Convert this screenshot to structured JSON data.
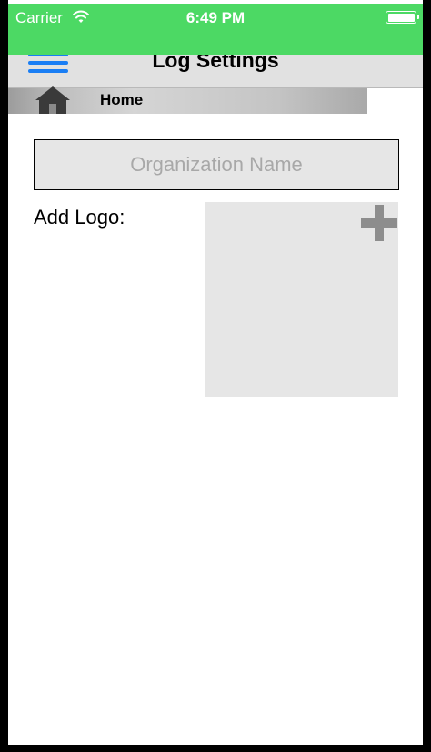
{
  "status_bar": {
    "carrier": "Carrier",
    "time": "6:49 PM",
    "wifi_icon": "wifi-icon",
    "battery_icon": "battery-icon",
    "background_color": "#4cd964"
  },
  "nav_bar": {
    "menu_icon": "hamburger-menu-icon",
    "title": "Log Settings",
    "menu_icon_color": "#1a7ef4"
  },
  "breadcrumb": {
    "icon": "home-icon",
    "label": "Home"
  },
  "form": {
    "organization_name": {
      "value": "",
      "placeholder": "Organization Name"
    },
    "logo_label": "Add Logo:",
    "logo_add_icon": "plus-icon"
  }
}
